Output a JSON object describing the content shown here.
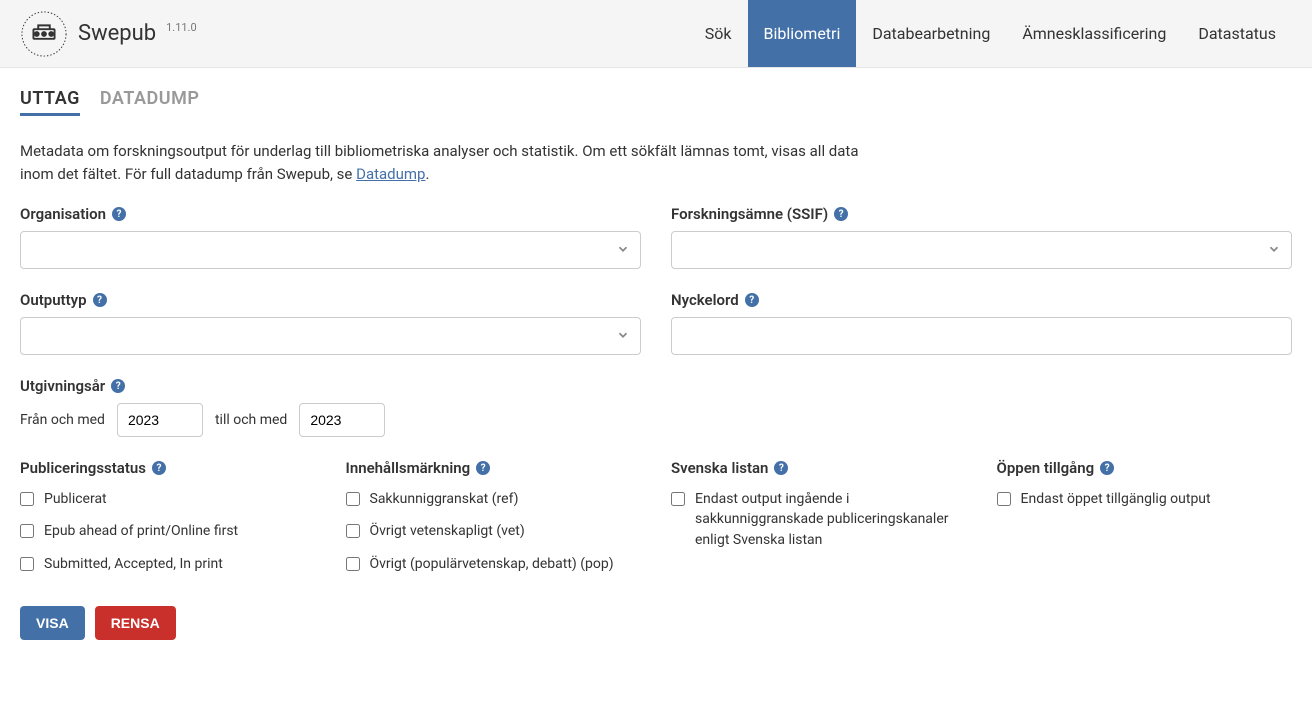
{
  "header": {
    "brand": "Swepub",
    "version": "1.11.0",
    "nav": [
      "Sök",
      "Bibliometri",
      "Databearbetning",
      "Ämnesklassificering",
      "Datastatus"
    ],
    "active_nav_index": 1
  },
  "tabs": {
    "items": [
      "UTTAG",
      "DATADUMP"
    ],
    "active_index": 0
  },
  "description": {
    "text_before": "Metadata om forskningsoutput för underlag till bibliometriska analyser och statistik. Om ett sökfält lämnas tomt, visas all data inom det fältet. För full datadump från Swepub, se ",
    "link_text": "Datadump",
    "text_after": "."
  },
  "fields": {
    "organisation": {
      "label": "Organisation"
    },
    "ssif": {
      "label": "Forskningsämne (SSIF)"
    },
    "outputtyp": {
      "label": "Outputtyp"
    },
    "nyckelord": {
      "label": "Nyckelord"
    },
    "utgivningsar": {
      "label": "Utgivningsår",
      "from_label": "Från och med",
      "to_label": "till och med",
      "from_value": "2023",
      "to_value": "2023"
    }
  },
  "check_groups": {
    "publiceringsstatus": {
      "label": "Publiceringsstatus",
      "items": [
        "Publicerat",
        "Epub ahead of print/Online first",
        "Submitted, Accepted, In print"
      ]
    },
    "innehallsmarkning": {
      "label": "Innehållsmärkning",
      "items": [
        "Sakkunniggranskat (ref)",
        "Övrigt vetenskapligt (vet)",
        "Övrigt (populärvetenskap, debatt) (pop)"
      ]
    },
    "svenska_listan": {
      "label": "Svenska listan",
      "items": [
        "Endast output ingående i sakkunniggranskade publiceringskanaler enligt Svenska listan"
      ]
    },
    "oppen_tillgang": {
      "label": "Öppen tillgång",
      "items": [
        "Endast öppet tillgänglig output"
      ]
    }
  },
  "buttons": {
    "visa": "VISA",
    "rensa": "RENSA"
  },
  "icons": {
    "help_glyph": "?"
  }
}
